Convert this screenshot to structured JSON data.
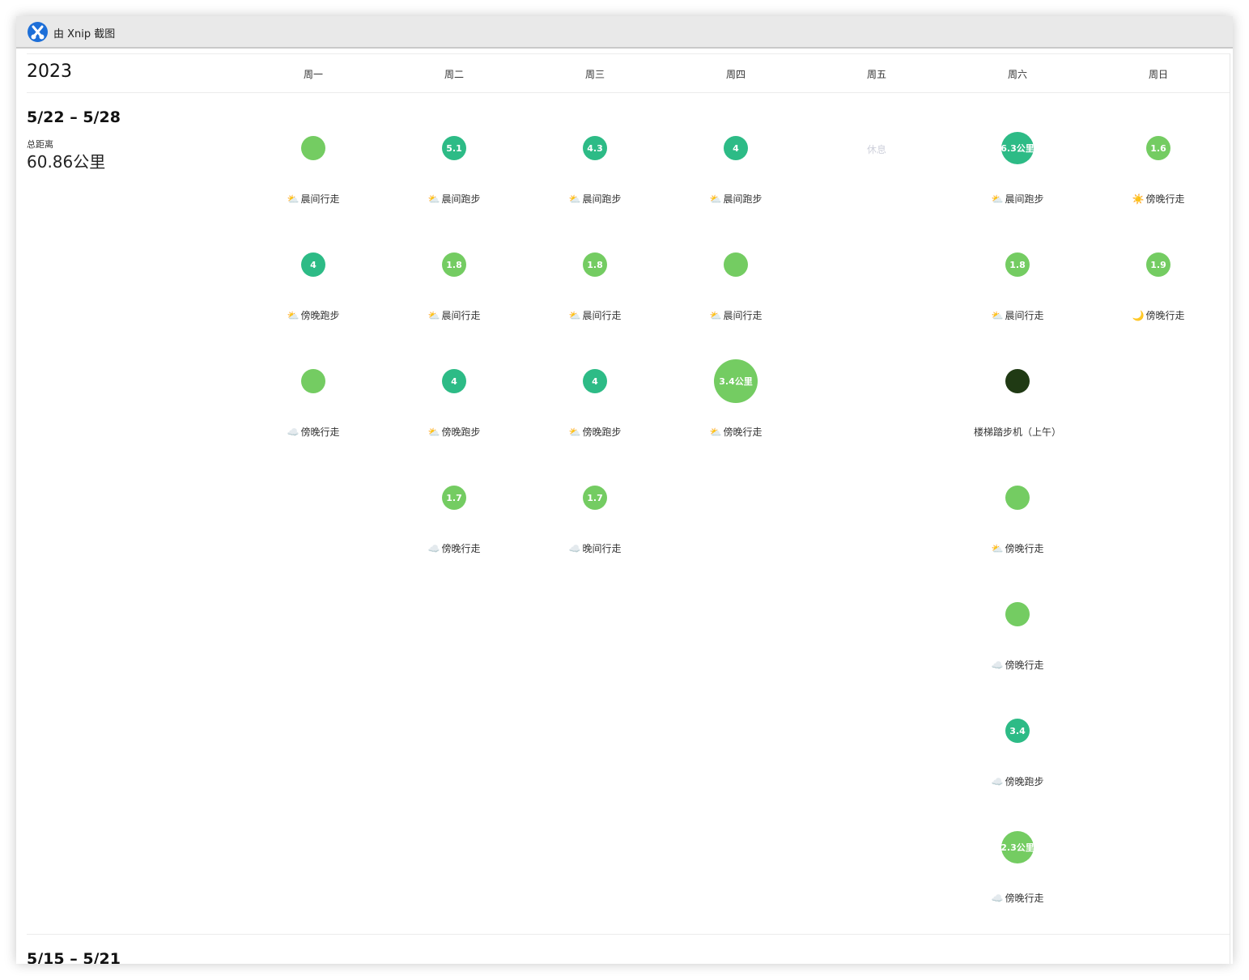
{
  "window": {
    "title": "由 Xnip 截图"
  },
  "header": {
    "year": "2023",
    "days": [
      "周一",
      "周二",
      "周三",
      "周四",
      "周五",
      "周六",
      "周日"
    ]
  },
  "colors": {
    "light_green": "#74cc62",
    "teal_green": "#2dbb86",
    "dark": "#203a14",
    "rest_text": "#cfd1dc"
  },
  "weeks": [
    {
      "range": "5/22 – 5/28",
      "total_label": "总距离",
      "total_value": "60.86公里",
      "days": [
        [
          {
            "value": "",
            "color": "light_green",
            "label": "晨间行走",
            "weather": "⛅"
          },
          {
            "value": "4",
            "color": "teal_green",
            "label": "傍晚跑步",
            "weather": "⛅"
          },
          {
            "value": "",
            "color": "light_green",
            "label": "傍晚行走",
            "weather": "☁️"
          }
        ],
        [
          {
            "value": "5.1",
            "color": "teal_green",
            "label": "晨间跑步",
            "weather": "⛅"
          },
          {
            "value": "1.8",
            "color": "light_green",
            "label": "晨间行走",
            "weather": "⛅"
          },
          {
            "value": "4",
            "color": "teal_green",
            "label": "傍晚跑步",
            "weather": "⛅"
          },
          {
            "value": "1.7",
            "color": "light_green",
            "label": "傍晚行走",
            "weather": "☁️"
          }
        ],
        [
          {
            "value": "4.3",
            "color": "teal_green",
            "label": "晨间跑步",
            "weather": "⛅"
          },
          {
            "value": "1.8",
            "color": "light_green",
            "label": "晨间行走",
            "weather": "⛅"
          },
          {
            "value": "4",
            "color": "teal_green",
            "label": "傍晚跑步",
            "weather": "⛅"
          },
          {
            "value": "1.7",
            "color": "light_green",
            "label": "晚间行走",
            "weather": "☁️"
          }
        ],
        [
          {
            "value": "4",
            "color": "teal_green",
            "label": "晨间跑步",
            "weather": "⛅"
          },
          {
            "value": "",
            "color": "light_green",
            "label": "晨间行走",
            "weather": "⛅"
          },
          {
            "value": "3.4公里",
            "color": "light_green",
            "label": "傍晚行走",
            "weather": "⛅",
            "large": true
          }
        ],
        [
          {
            "rest": "休息"
          }
        ],
        [
          {
            "value": "6.3公里",
            "color": "teal_green",
            "label": "晨间跑步",
            "weather": "⛅",
            "medium": true
          },
          {
            "value": "1.8",
            "color": "light_green",
            "label": "晨间行走",
            "weather": "⛅"
          },
          {
            "value": "",
            "color": "dark",
            "label": "楼梯踏步机（上午）",
            "weather": ""
          },
          {
            "value": "",
            "color": "light_green",
            "label": "傍晚行走",
            "weather": "⛅"
          },
          {
            "value": "",
            "color": "light_green",
            "label": "傍晚行走",
            "weather": "☁️"
          },
          {
            "value": "3.4",
            "color": "teal_green",
            "label": "傍晚跑步",
            "weather": "☁️"
          },
          {
            "value": "2.3公里",
            "color": "light_green",
            "label": "傍晚行走",
            "weather": "☁️",
            "medium": true
          }
        ],
        [
          {
            "value": "1.6",
            "color": "light_green",
            "label": "傍晚行走",
            "weather": "☀️"
          },
          {
            "value": "1.9",
            "color": "light_green",
            "label": "傍晚行走",
            "weather": "🌙"
          }
        ]
      ]
    },
    {
      "range": "5/15 – 5/21"
    }
  ]
}
